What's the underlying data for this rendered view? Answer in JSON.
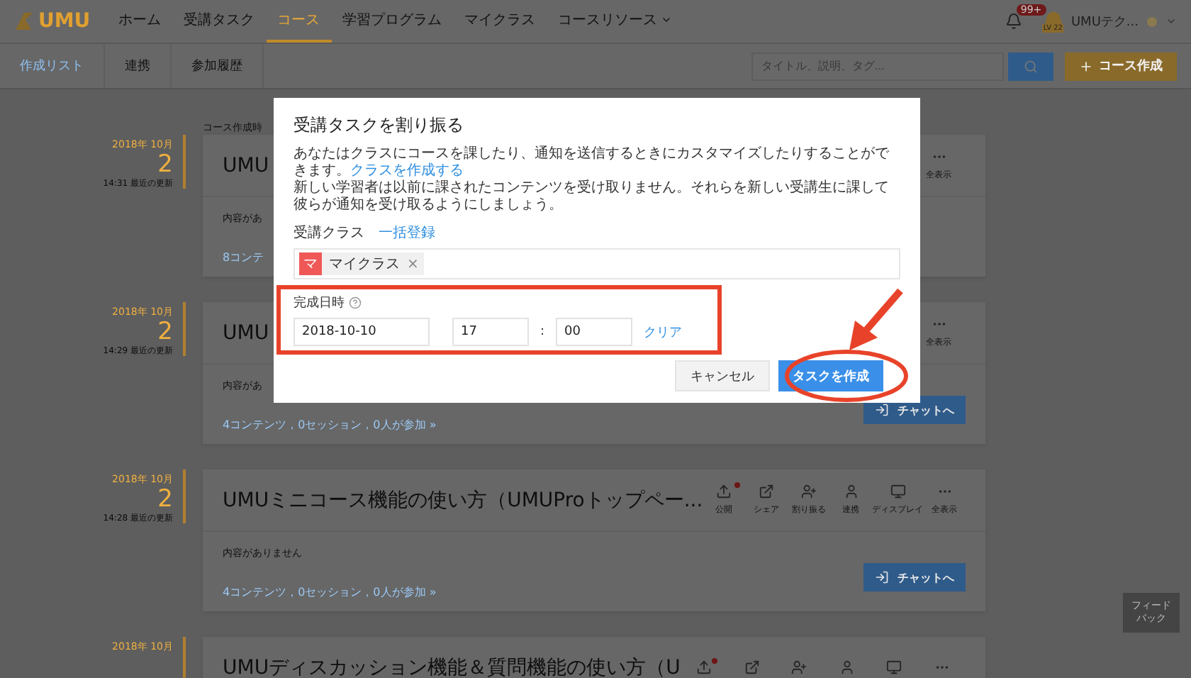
{
  "header": {
    "logo": "UMU",
    "nav": [
      {
        "label": "ホーム",
        "selected": false
      },
      {
        "label": "受講タスク",
        "selected": false
      },
      {
        "label": "コース",
        "selected": true
      },
      {
        "label": "学習プログラム",
        "selected": false
      },
      {
        "label": "マイクラス",
        "selected": false
      },
      {
        "label": "コースリソース",
        "selected": false,
        "dropdown": true
      }
    ],
    "notification_badge": "99+",
    "user": {
      "level": "LV 22",
      "name": "UMUテク..."
    }
  },
  "subnav": {
    "tabs": [
      {
        "label": "作成リスト",
        "selected": true
      },
      {
        "label": "連携",
        "selected": false
      },
      {
        "label": "参加履歴",
        "selected": false
      }
    ],
    "search": {
      "placeholder": "タイトル、説明、タグ..."
    },
    "create_button": "コース作成"
  },
  "sort_label": "コース作成時",
  "courses": [
    {
      "month": "2018年 10月",
      "day": "2",
      "updated": "14:31 最近の更新",
      "title": "UMU",
      "empty_text": "内容があ",
      "stats": "8コンテ",
      "actions": [
        {
          "kind": "more",
          "label": "全表示",
          "notify": false
        }
      ]
    },
    {
      "month": "2018年 10月",
      "day": "2",
      "updated": "14:29 最近の更新",
      "title": "UMU",
      "empty_text": "内容があ",
      "stats": "4コンテンツ，0セッション，0人が参加 »",
      "chat_button": "チャットへ",
      "actions": [
        {
          "kind": "more",
          "label": "全表示",
          "notify": false
        }
      ]
    },
    {
      "month": "2018年 10月",
      "day": "2",
      "updated": "14:28 最近の更新",
      "title": "UMUミニコース機能の使い方（UMUProトップペー...",
      "empty_text": "内容がありません",
      "stats": "4コンテンツ，0セッション，0人が参加 »",
      "chat_button": "チャットへ",
      "actions": [
        {
          "kind": "publish",
          "label": "公開",
          "notify": true
        },
        {
          "kind": "share",
          "label": "シェア",
          "notify": false
        },
        {
          "kind": "assign",
          "label": "割り振る",
          "notify": false
        },
        {
          "kind": "link",
          "label": "連携",
          "notify": false
        },
        {
          "kind": "display",
          "label": "ディスプレイ",
          "notify": false
        },
        {
          "kind": "more",
          "label": "全表示",
          "notify": false
        }
      ]
    },
    {
      "month": "2018年 10月",
      "title": "UMUディスカッション機能＆質問機能の使い方（U",
      "actions": [
        {
          "kind": "publish",
          "notify": true
        },
        {
          "kind": "share",
          "notify": false
        },
        {
          "kind": "assign",
          "notify": false
        },
        {
          "kind": "link",
          "notify": false
        },
        {
          "kind": "display",
          "notify": false
        },
        {
          "kind": "more",
          "notify": false
        }
      ]
    }
  ],
  "feedback_button": "フィードバック",
  "dialog": {
    "title": "受講タスクを割り振る",
    "description": "あなたはクラスにコースを課したり、通知を送信するときにカスタマイズしたりすることができます。",
    "description_link": "クラスを作成する",
    "note": "新しい学習者は以前に課されたコンテンツを受け取りません。それらを新しい受講生に課して彼らが通知を受け取るようにしましょう。",
    "class_label": "受講クラス",
    "bulk_link": "一括登録",
    "classes": [
      {
        "initial": "マ",
        "name": "マイクラス",
        "remove": "×"
      }
    ],
    "due_label": "完成日時",
    "date": "2018-10-10",
    "hour": "17",
    "separator": ":",
    "minute": "00",
    "clear_link": "クリア",
    "cancel_button": "キャンセル",
    "submit_button": "タスクを作成",
    "highlight_due": true,
    "highlight_submit": true
  }
}
